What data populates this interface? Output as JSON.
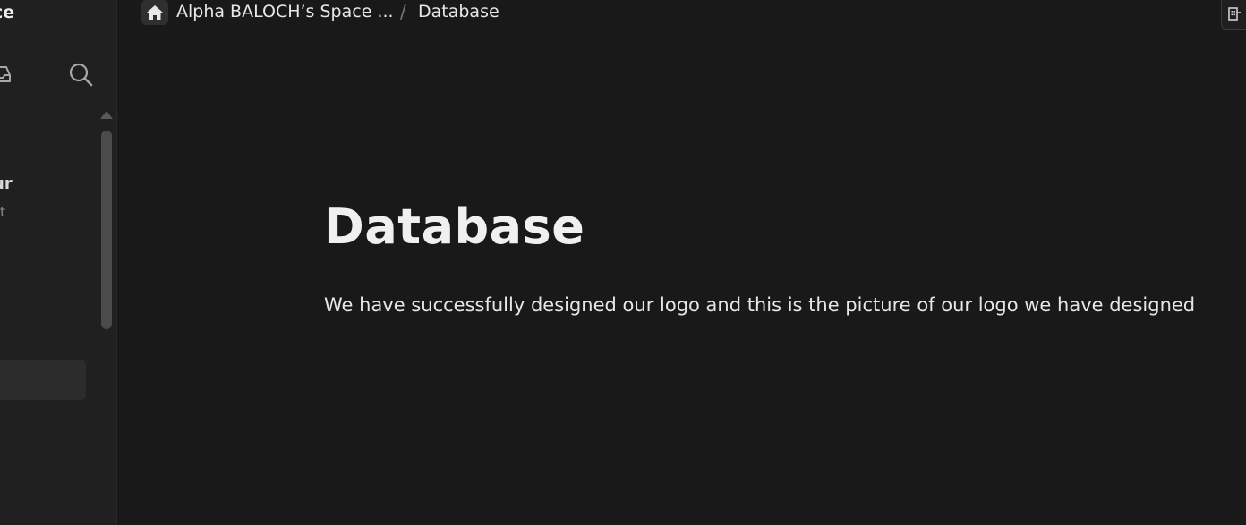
{
  "sidebar": {
    "workspace_title_fragment": "ce",
    "page_item_title_fragment": "ur",
    "page_item_subtitle_fragment": "rt",
    "icons": [
      "inbox-icon",
      "search-icon"
    ]
  },
  "topbar": {
    "home_icon": "home-icon",
    "breadcrumb": {
      "workspace": "Alpha BALOCH’s Space ...",
      "separator": "/",
      "current": "Database"
    },
    "right_icon": "building-icon"
  },
  "page": {
    "title": "Database",
    "paragraph": "We have successfully designed our logo and this is the picture of our logo we have designed"
  },
  "colors": {
    "background": "#191919",
    "sidebar": "#202020",
    "text": "#e6e6e6",
    "muted": "#8a8a8a"
  }
}
